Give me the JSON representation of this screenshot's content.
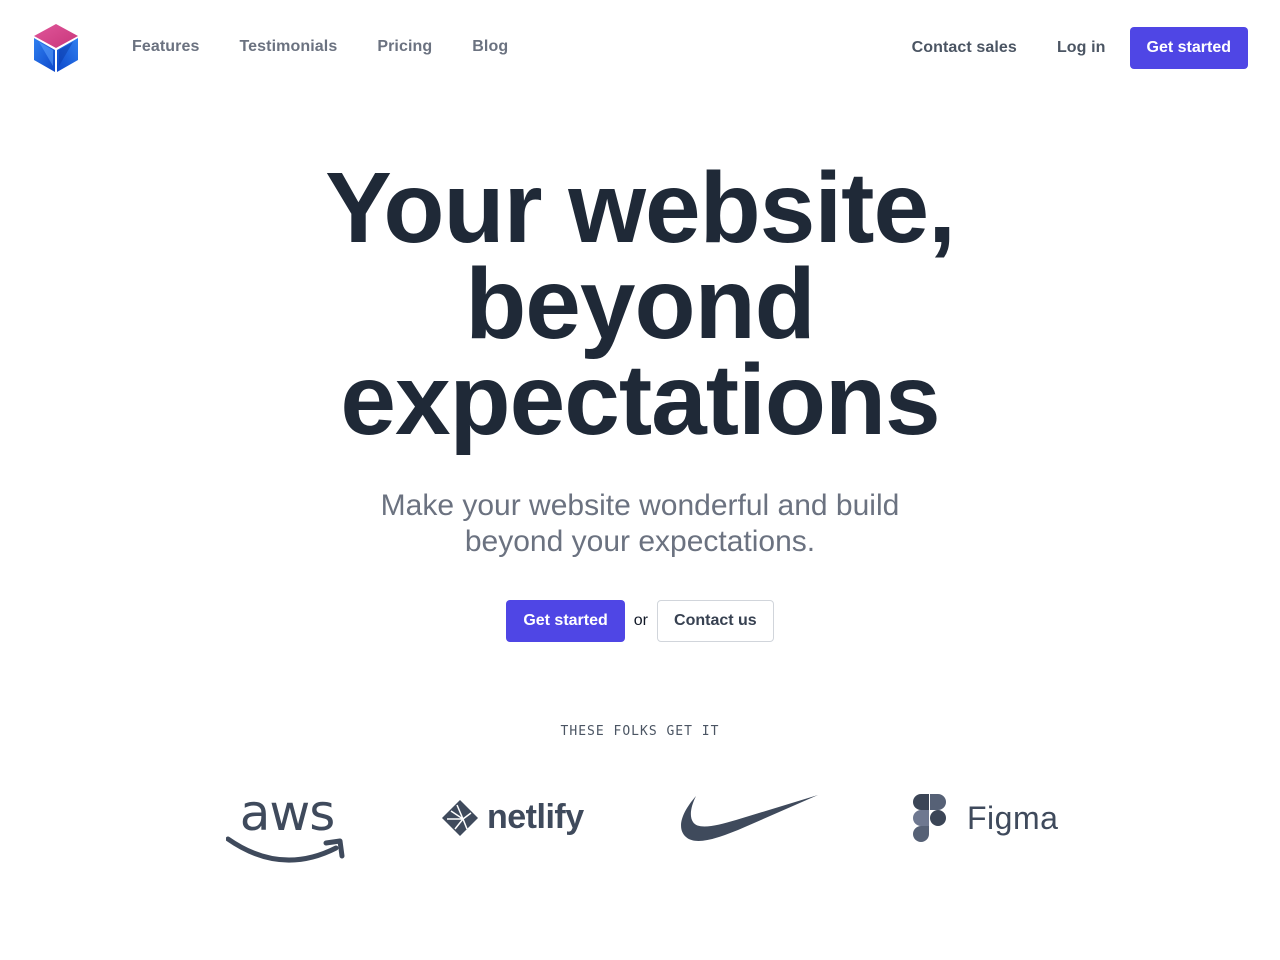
{
  "nav": {
    "logo": "cube-logo",
    "links": [
      {
        "label": "Features"
      },
      {
        "label": "Testimonials"
      },
      {
        "label": "Pricing"
      },
      {
        "label": "Blog"
      }
    ],
    "contact_sales": "Contact sales",
    "login": "Log in",
    "get_started": "Get started"
  },
  "hero": {
    "title_lines": [
      "Your website,",
      "beyond",
      "expectations"
    ],
    "subtitle_lines": [
      "Make your website wonderful and build",
      "beyond your expectations."
    ],
    "primary_cta": "Get started",
    "or_text": "or",
    "secondary_cta": "Contact us"
  },
  "social_proof": {
    "heading": "THESE FOLKS GET IT",
    "logos": [
      {
        "name": "aws",
        "text": "aws"
      },
      {
        "name": "netlify",
        "text": "netlify"
      },
      {
        "name": "nike",
        "text": ""
      },
      {
        "name": "figma",
        "text": "Figma"
      }
    ]
  },
  "colors": {
    "accent": "#4f46e5",
    "heading": "#1f2937",
    "muted": "#6b7280",
    "logo_gray": "#3f4a5c"
  }
}
